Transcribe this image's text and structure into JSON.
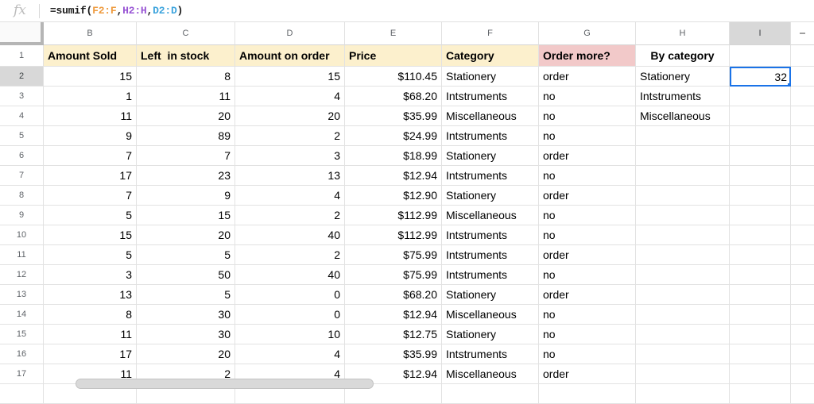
{
  "formula_bar": {
    "fx_label": "fx",
    "formula_tokens": [
      {
        "text": "=sumif(",
        "color": "#1a1a1a"
      },
      {
        "text": "F2:F",
        "color": "#ee9b3f"
      },
      {
        "text": ",",
        "color": "#1a1a1a"
      },
      {
        "text": "H2:H",
        "color": "#9855d4"
      },
      {
        "text": ",",
        "color": "#1a1a1a"
      },
      {
        "text": "D2:D",
        "color": "#3da4dd"
      },
      {
        "text": ")",
        "color": "#1a1a1a"
      }
    ]
  },
  "sheet": {
    "column_letters": [
      "B",
      "C",
      "D",
      "E",
      "F",
      "G",
      "H",
      "I",
      ""
    ],
    "selected": {
      "column": "I",
      "row": "2",
      "value": "32"
    },
    "colors": {
      "header_yellow": "#fcf0cd",
      "header_pink": "#f2c9c9",
      "selected_header_bg": "#d8d8d8",
      "selection_blue": "#1a73e8"
    },
    "header_row": {
      "n": "1",
      "cells": [
        {
          "col": "B",
          "text": "Amount Sold",
          "bg": "#fcf0cd",
          "align": "left"
        },
        {
          "col": "C",
          "text": "Left  in stock",
          "bg": "#fcf0cd",
          "align": "left"
        },
        {
          "col": "D",
          "text": "Amount on order",
          "bg": "#fcf0cd",
          "align": "left"
        },
        {
          "col": "E",
          "text": "Price",
          "bg": "#fcf0cd",
          "align": "left"
        },
        {
          "col": "F",
          "text": "Category",
          "bg": "#fcf0cd",
          "align": "left"
        },
        {
          "col": "G",
          "text": "Order more?",
          "bg": "#f2c9c9",
          "align": "left"
        },
        {
          "col": "H",
          "text": "By category",
          "bg": "",
          "align": "center"
        },
        {
          "col": "I",
          "text": "",
          "bg": "",
          "align": "left"
        },
        {
          "col": "J",
          "text": "",
          "bg": "",
          "align": "left"
        }
      ]
    },
    "rows": [
      {
        "n": "2",
        "B": "15",
        "C": "8",
        "D": "15",
        "E": "$110.45",
        "F": "Stationery",
        "G": "order",
        "H": "Stationery",
        "I": "32"
      },
      {
        "n": "3",
        "B": "1",
        "C": "11",
        "D": "4",
        "E": "$68.20",
        "F": "Intstruments",
        "G": "no",
        "H": "Intstruments",
        "I": ""
      },
      {
        "n": "4",
        "B": "11",
        "C": "20",
        "D": "20",
        "E": "$35.99",
        "F": "Miscellaneous",
        "G": "no",
        "H": "Miscellaneous",
        "I": ""
      },
      {
        "n": "5",
        "B": "9",
        "C": "89",
        "D": "2",
        "E": "$24.99",
        "F": "Intstruments",
        "G": "no",
        "H": "",
        "I": ""
      },
      {
        "n": "6",
        "B": "7",
        "C": "7",
        "D": "3",
        "E": "$18.99",
        "F": "Stationery",
        "G": "order",
        "H": "",
        "I": ""
      },
      {
        "n": "7",
        "B": "17",
        "C": "23",
        "D": "13",
        "E": "$12.94",
        "F": "Intstruments",
        "G": "no",
        "H": "",
        "I": ""
      },
      {
        "n": "8",
        "B": "7",
        "C": "9",
        "D": "4",
        "E": "$12.90",
        "F": "Stationery",
        "G": "order",
        "H": "",
        "I": ""
      },
      {
        "n": "9",
        "B": "5",
        "C": "15",
        "D": "2",
        "E": "$112.99",
        "F": "Miscellaneous",
        "G": "no",
        "H": "",
        "I": ""
      },
      {
        "n": "10",
        "B": "15",
        "C": "20",
        "D": "40",
        "E": "$112.99",
        "F": "Intstruments",
        "G": "no",
        "H": "",
        "I": ""
      },
      {
        "n": "11",
        "B": "5",
        "C": "5",
        "D": "2",
        "E": "$75.99",
        "F": "Intstruments",
        "G": "order",
        "H": "",
        "I": ""
      },
      {
        "n": "12",
        "B": "3",
        "C": "50",
        "D": "40",
        "E": "$75.99",
        "F": "Intstruments",
        "G": "no",
        "H": "",
        "I": ""
      },
      {
        "n": "13",
        "B": "13",
        "C": "5",
        "D": "0",
        "E": "$68.20",
        "F": "Stationery",
        "G": "order",
        "H": "",
        "I": ""
      },
      {
        "n": "14",
        "B": "8",
        "C": "30",
        "D": "0",
        "E": "$12.94",
        "F": "Miscellaneous",
        "G": "no",
        "H": "",
        "I": ""
      },
      {
        "n": "15",
        "B": "11",
        "C": "30",
        "D": "10",
        "E": "$12.75",
        "F": "Stationery",
        "G": "no",
        "H": "",
        "I": ""
      },
      {
        "n": "16",
        "B": "17",
        "C": "20",
        "D": "4",
        "E": "$35.99",
        "F": "Intstruments",
        "G": "no",
        "H": "",
        "I": ""
      },
      {
        "n": "17",
        "B": "11",
        "C": "2",
        "D": "4",
        "E": "$12.94",
        "F": "Miscellaneous",
        "G": "order",
        "H": "",
        "I": ""
      }
    ]
  }
}
